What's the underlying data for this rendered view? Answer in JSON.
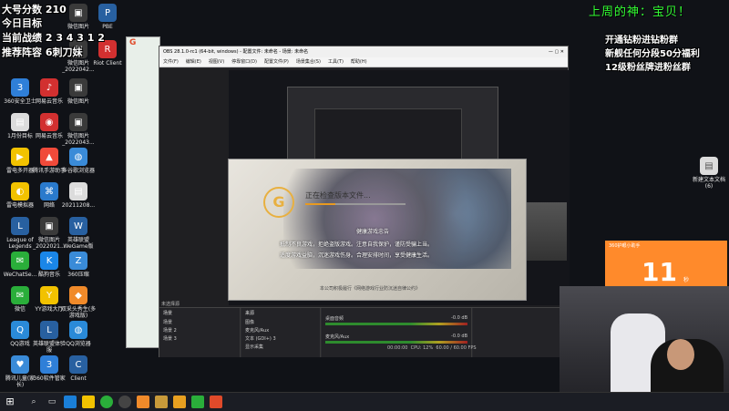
{
  "overlay": {
    "score_line": "大号分数 210",
    "goal_line": "今日目标",
    "streak_line": "当前战绩 2 3 4 3 1 2",
    "recommend_line": "推荐阵容 6刺刀妹",
    "top_right_banner": "上周的神：宝贝！",
    "right_line1": "开通钻粉进钻粉群",
    "right_line2": "新舰任何分段50分福利",
    "right_line3": "12级粉丝牌进粉丝群"
  },
  "desktop_icons": [
    {
      "label": "360安全卫士",
      "color": "#2f7fd8",
      "glyph": "3"
    },
    {
      "label": "网易云音乐",
      "color": "#d23030",
      "glyph": "♪"
    },
    {
      "label": "微信图片",
      "color": "#3a3a3a",
      "glyph": "▣"
    },
    {
      "label": "1月份目标",
      "color": "#dcdcdc",
      "glyph": "▤"
    },
    {
      "label": "网易云音乐",
      "color": "#d23030",
      "glyph": "◉"
    },
    {
      "label": "微信图片_2022043...",
      "color": "#3a3a3a",
      "glyph": "▣"
    },
    {
      "label": "雷电多开器",
      "color": "#f2c200",
      "glyph": "▶"
    },
    {
      "label": "腾讯手游助手",
      "color": "#f04a3a",
      "glyph": "▲"
    },
    {
      "label": "多谷歌浏览器",
      "color": "#3a8bd8",
      "glyph": "◍"
    },
    {
      "label": "雷电模拟器",
      "color": "#f2c200",
      "glyph": "◐"
    },
    {
      "label": "网络",
      "color": "#2a7acc",
      "glyph": "⌘"
    },
    {
      "label": "20211208...",
      "color": "#dcdcdc",
      "glyph": "▤"
    },
    {
      "label": "League of Legends",
      "color": "#2860a0",
      "glyph": "L"
    },
    {
      "label": "微信图片_2022021...",
      "color": "#3a3a3a",
      "glyph": "▣"
    },
    {
      "label": "英雄联盟WeGame版",
      "color": "#2860a0",
      "glyph": "W"
    },
    {
      "label": "WeChatSe...",
      "color": "#2aae3a",
      "glyph": "✉"
    },
    {
      "label": "酷狗音乐",
      "color": "#1a86e8",
      "glyph": "K"
    },
    {
      "label": "360压缩",
      "color": "#3a8bd8",
      "glyph": "Z"
    },
    {
      "label": "微信",
      "color": "#2aae3a",
      "glyph": "✉"
    },
    {
      "label": "YY游戏大厅",
      "color": "#f2c200",
      "glyph": "Y"
    },
    {
      "label": "双采头秀生(多游戏版)",
      "color": "#f08a2a",
      "glyph": "◆"
    },
    {
      "label": "QQ游戏",
      "color": "#2a8ad8",
      "glyph": "Q"
    },
    {
      "label": "英雄联盟体验服",
      "color": "#2860a0",
      "glyph": "L"
    },
    {
      "label": "QQ浏览器",
      "color": "#2a8ad8",
      "glyph": "◍"
    },
    {
      "label": "腾讯儿童(家长)",
      "color": "#3a8bd8",
      "glyph": "♥"
    },
    {
      "label": "360软件管家",
      "color": "#2f7fd8",
      "glyph": "3"
    },
    {
      "label": "Client",
      "color": "#2860a0",
      "glyph": "C"
    }
  ],
  "top_icons": [
    {
      "label": "微信图片",
      "color": "#3a3a3a",
      "glyph": "▣"
    },
    {
      "label": "PBE",
      "color": "#2860a0",
      "glyph": "P"
    },
    {
      "label": "微信图片_2022042...",
      "color": "#3a3a3a",
      "glyph": "▣"
    },
    {
      "label": "Riot Client",
      "color": "#d23030",
      "glyph": "R"
    }
  ],
  "right_icon": {
    "label": "新建文本文档(6)",
    "color": "#dcdcdc",
    "glyph": "▤"
  },
  "obs": {
    "title": "OBS 28.1.0-rc1 (64-bit, windows) - 配置文件: 未命名 - 场景: 未命名",
    "menu": [
      "文件(F)",
      "编辑(E)",
      "视图(V)",
      "停靠窗口(D)",
      "配置文件(P)",
      "场景集合(S)",
      "工具(T)",
      "帮助(H)"
    ],
    "no_source": "未选择源",
    "scenes_header": "场景",
    "scenes": [
      "场景",
      "场景 2",
      "场景 3"
    ],
    "sources_header": "来源",
    "sources": [
      "图像",
      "麦克风/Aux",
      "文本 (GDI+) 3",
      "显示采集"
    ],
    "mixer": [
      "桌面音频",
      "麦克风/Aux"
    ],
    "mixer_db": [
      "-0.0 dB",
      "-0.0 dB"
    ],
    "status_time": "00:00:00",
    "status_cpu": "CPU: 12%",
    "status_fps": "60.00 / 60.00 FPS"
  },
  "loader": {
    "checking": "正在检查版本文件...",
    "notice_title": "健康游戏忠告",
    "notice_lines": [
      "抵制不良游戏，拒绝盗版游戏。注意自我保护，谨防受骗上当。",
      "适度游戏益脑，沉迷游戏伤身。合理安排时间，享受健康生活。"
    ],
    "footer": "本公司积极履行《网络游戏行业防沉迷自律公约》"
  },
  "timer": {
    "title": "360护眼小助手",
    "value": "11",
    "unit": "秒"
  },
  "taskbar": {
    "icons": [
      "windows-logo",
      "search",
      "task-view",
      "edge",
      "file-explorer",
      "chrome",
      "obs",
      "wegame",
      "league",
      "qq",
      "wechat",
      "game"
    ]
  }
}
